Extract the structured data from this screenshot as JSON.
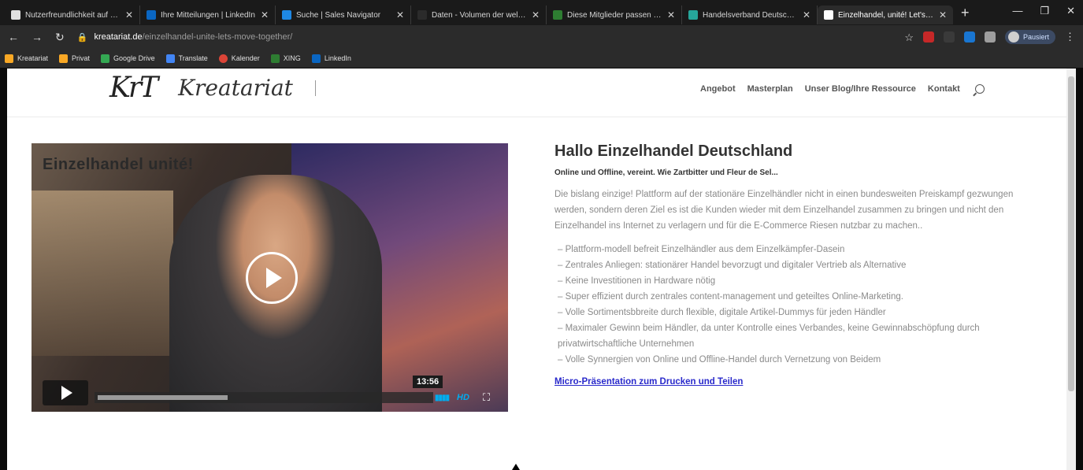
{
  "browser": {
    "tabs": [
      {
        "label": "Nutzerfreundlichkeit auf Mobilg",
        "color": "#e0e0e0"
      },
      {
        "label": "Ihre Mitteilungen | LinkedIn",
        "color": "#0a66c2"
      },
      {
        "label": "Suche | Sales Navigator",
        "color": "#1e88e5"
      },
      {
        "label": "Daten - Volumen der weltweit ge",
        "color": "#2b2b2b"
      },
      {
        "label": "Diese Mitglieder passen zum Suc",
        "color": "#2e7d32"
      },
      {
        "label": "Handelsverband Deutschland (H",
        "color": "#26a69a"
      },
      {
        "label": "Einzelhandel, unité! Let's move t",
        "color": "#ffffff",
        "active": true
      }
    ],
    "url_host": "kreatariat.de",
    "url_path": "/einzelhandel-unite-lets-move-together/",
    "profile_status": "Pausiert",
    "bookmarks": [
      "Kreatariat",
      "Privat",
      "Google Drive",
      "Translate",
      "Kalender",
      "XING",
      "LinkedIn"
    ]
  },
  "site": {
    "menu": [
      "Angebot",
      "Masterplan",
      "Unser Blog/Ihre Ressource",
      "Kontakt"
    ],
    "logo_mark": "KrT",
    "logo_word": "Kreatariat"
  },
  "video": {
    "title": "Einzelhandel unité!",
    "duration": "13:56",
    "progress": 0.39,
    "quality": "HD"
  },
  "content": {
    "heading": "Hallo Einzelhandel Deutschland",
    "subheading": "Online und Offline, vereint. Wie Zartbitter und Fleur de Sel...",
    "intro": "Die bislang einzige! Plattform auf der stationäre Einzelhändler nicht in einen bundesweiten Preiskampf gezwungen werden, sondern deren Ziel es ist die Kunden wieder mit dem Einzelhandel zusammen zu bringen und nicht den Einzelhandel ins Internet zu verlagern und für die E-Commerce Riesen nutzbar zu machen..",
    "bullets": [
      "– Plattform-modell befreit Einzelhändler aus dem Einzelkämpfer-Dasein",
      "– Zentrales Anliegen: stationärer Handel bevorzugt und digitaler Vertrieb als Alternative",
      "– Keine Investitionen in Hardware nötig",
      "– Super effizient durch zentrales content-management und geteiltes Online-Marketing.",
      "– Volle Sortimentsbbreite durch flexible, digitale Artikel-Dummys für jeden Händler",
      "– Maximaler Gewinn beim Händler, da unter Kontrolle eines Verbandes, keine Gewinnabschöpfung durch privatwirtschaftliche Unternehmen",
      "– Volle Synnergien von Online und Offline-Handel durch Vernetzung von Beidem"
    ],
    "link": "Micro-Präsentation zum Drucken und Teilen"
  }
}
